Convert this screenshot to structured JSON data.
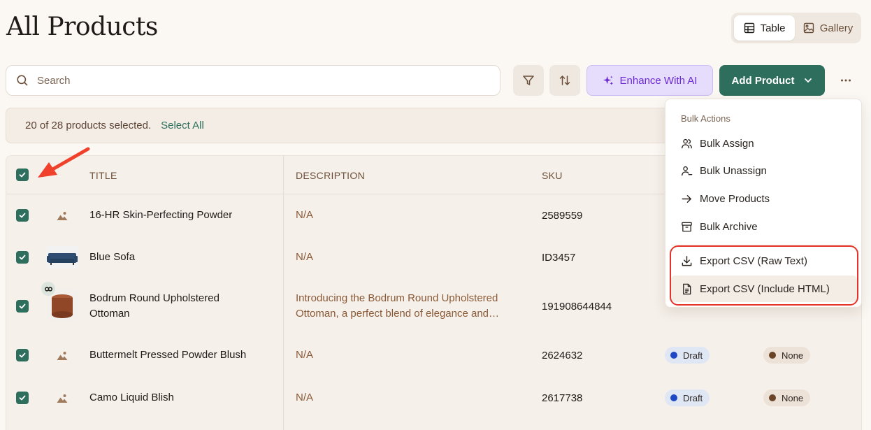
{
  "page": {
    "title": "All Products"
  },
  "view_toggle": {
    "table_label": "Table",
    "gallery_label": "Gallery",
    "active": "Table"
  },
  "toolbar": {
    "search_placeholder": "Search",
    "enhance_label": "Enhance With AI",
    "add_label": "Add Product"
  },
  "selection": {
    "count_text": "20 of 28 products selected.",
    "select_all_label": "Select All"
  },
  "table": {
    "columns": [
      "TITLE",
      "DESCRIPTION",
      "SKU"
    ],
    "rows": [
      {
        "title": "16-HR Skin-Perfecting Powder",
        "description": "N/A",
        "sku": "2589559",
        "image": "placeholder"
      },
      {
        "title": "Blue Sofa",
        "description": "N/A",
        "sku": "ID3457",
        "image": "sofa"
      },
      {
        "title": "Bodrum Round Upholstered Ottoman",
        "description": "Introducing the Bodrum Round Upholstered Ottoman, a perfect blend of elegance and…",
        "sku": "191908644844",
        "image": "ottoman"
      },
      {
        "title": "Buttermelt Pressed Powder Blush",
        "description": "N/A",
        "sku": "2624632",
        "image": "placeholder",
        "status": "Draft",
        "assignee": "None"
      },
      {
        "title": "Camo Liquid Blish",
        "description": "N/A",
        "sku": "2617738",
        "image": "placeholder",
        "status": "Draft",
        "assignee": "None"
      }
    ]
  },
  "menu": {
    "section_label": "Bulk Actions",
    "items": [
      {
        "label": "Bulk Assign",
        "icon": "users-icon"
      },
      {
        "label": "Bulk Unassign",
        "icon": "user-minus-icon"
      },
      {
        "label": "Move Products",
        "icon": "arrow-right-icon"
      },
      {
        "label": "Bulk Archive",
        "icon": "archive-icon"
      },
      {
        "label": "Export CSV (Raw Text)",
        "icon": "download-icon"
      },
      {
        "label": "Export CSV (Include HTML)",
        "icon": "file-text-icon"
      }
    ]
  },
  "colors": {
    "accent_green": "#2e6e5d",
    "ai_purple": "#6a2bd0",
    "annotation_red": "#e5332a",
    "draft_dot": "#1f48c4",
    "none_dot": "#6b4428"
  }
}
